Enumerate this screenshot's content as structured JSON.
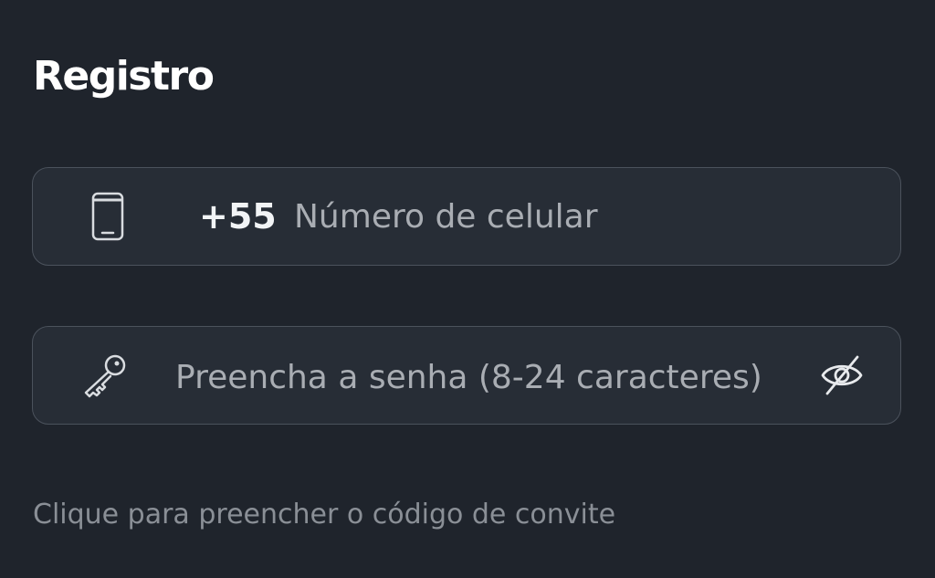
{
  "page": {
    "title": "Registro"
  },
  "phone_field": {
    "icon": "phone-icon",
    "country_code": "+55",
    "value": "",
    "placeholder": "Número de celular"
  },
  "password_field": {
    "icon": "key-icon",
    "value": "",
    "placeholder": "Preencha a senha (8-24 caracteres)",
    "visibility_toggle_icon": "eye-off-icon"
  },
  "invite_code": {
    "link_text": "Clique para preencher o código de convite"
  },
  "colors": {
    "background": "#1f242c",
    "field_background": "#272d36",
    "field_border": "#4b525c",
    "title_text": "#ffffff",
    "placeholder_text": "#a9adb3",
    "muted_link": "#8a8f96"
  }
}
